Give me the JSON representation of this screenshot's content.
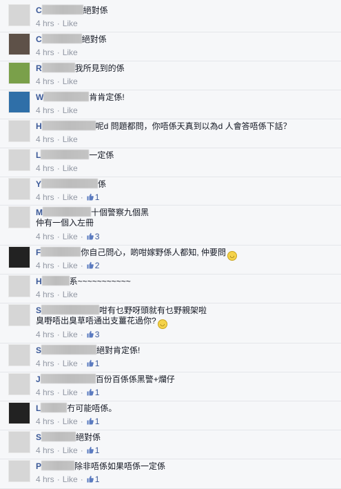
{
  "labels": {
    "time": "4 hrs",
    "dot": "·",
    "like": "Like"
  },
  "comments": [
    {
      "name": "C",
      "text": "絕對係",
      "lines": [],
      "likes": ""
    },
    {
      "name": "C",
      "text": "絕對係",
      "lines": [],
      "likes": ""
    },
    {
      "name": "R",
      "text": "我所見到的係",
      "lines": [],
      "likes": ""
    },
    {
      "name": "W",
      "text": "肯肯定係!",
      "lines": [],
      "likes": ""
    },
    {
      "name": "H",
      "text": "呢d 問題都問，你唔係天真到以為d 人會答唔係下話？",
      "lines": [],
      "likes": ""
    },
    {
      "name": "L",
      "text": "一定係",
      "lines": [],
      "likes": ""
    },
    {
      "name": "Y",
      "text": "係",
      "lines": [],
      "likes": "1"
    },
    {
      "name": "M",
      "text": "十個警察九個黑",
      "lines": [
        "仲有一個入左冊"
      ],
      "likes": "3"
    },
    {
      "name": "F",
      "text": "你自己問心，啲咁嫁野係人都知, 仲要問",
      "lines": [],
      "likes": "2"
    },
    {
      "name": "H",
      "text": "系~~~~~~~~~~~",
      "lines": [],
      "likes": ""
    },
    {
      "name": "S",
      "text": "咁有乜野呀頭就有乜野親架啦",
      "lines": [
        "臭嘢唔出臭草唔通出支薑花過你?"
      ],
      "likes": "3"
    },
    {
      "name": "S",
      "text": "絕對肯定係!",
      "lines": [],
      "likes": "1"
    },
    {
      "name": "J",
      "text": "百份百係係黑警+爛仔",
      "lines": [],
      "likes": "1"
    },
    {
      "name": "L",
      "text": "冇可能唔係。",
      "lines": [],
      "likes": "1"
    },
    {
      "name": "S",
      "text": "絕對係",
      "lines": [],
      "likes": "1"
    },
    {
      "name": "P",
      "text": "除非唔係如果唔係一定係",
      "lines": [],
      "likes": "1"
    }
  ]
}
